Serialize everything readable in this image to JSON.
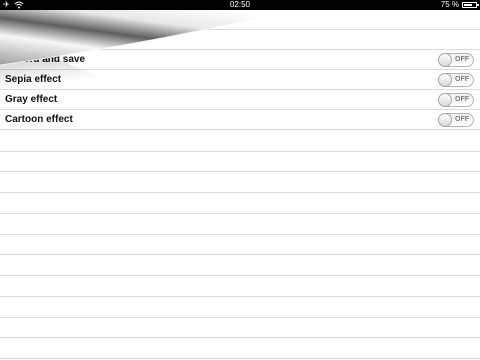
{
  "status_bar": {
    "time": "02:50",
    "battery_text": "75 %",
    "battery_level": 0.75,
    "icons": [
      "airplane-icon",
      "wifi-icon",
      "battery-icon"
    ]
  },
  "settings": {
    "rows": [
      {
        "label": "Record and save",
        "toggle": "OFF"
      },
      {
        "label": "Sepia effect",
        "toggle": "OFF"
      },
      {
        "label": "Gray effect",
        "toggle": "OFF"
      },
      {
        "label": "Cartoon effect",
        "toggle": "OFF"
      }
    ]
  }
}
